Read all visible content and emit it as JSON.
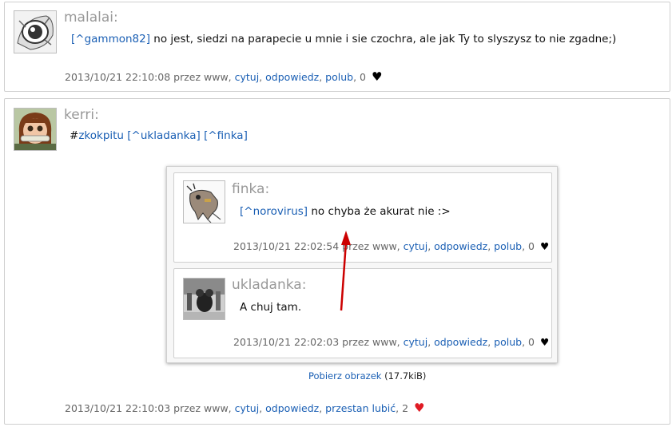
{
  "posts": [
    {
      "author": "malalai:",
      "mention": "[^gammon82]",
      "text": " no jest, siedzi na parapecie u mnie i sie czochra, ale jak Ty to slyszysz to nie zgadne;)",
      "date": "2013/10/21 22:10:08",
      "by": " przez www, ",
      "quote": "cytuj",
      "reply": "odpowiedz",
      "like": "polub",
      "count": ", 0 ",
      "heart": "♥"
    },
    {
      "author": "kerri:",
      "hashtag_prefix": "#",
      "hashtag": "zkokpitu",
      "mention1": "[^ukladanka]",
      "mention2": "[^finka]",
      "date": "2013/10/21 22:10:03",
      "by": " przez www, ",
      "quote": "cytuj",
      "reply": "odpowiedz",
      "like": "przestan lubić",
      "count": ", 2 ",
      "heart": "♥",
      "heart_color": "#e01b24"
    }
  ],
  "embedded": {
    "posts": [
      {
        "author": "finka:",
        "mention": "[^norovirus]",
        "text": " no chyba że akurat nie :>",
        "date": "2013/10/21 22:02:54",
        "by": " przez www, ",
        "quote": "cytuj",
        "reply": "odpowiedz",
        "like": "polub",
        "count": ", 0 ",
        "heart": "♥"
      },
      {
        "author": "ukladanka:",
        "text": "A chuj tam.",
        "date": "2013/10/21 22:02:03",
        "by": " przez www, ",
        "quote": "cytuj",
        "reply": "odpowiedz",
        "like": "polub",
        "count": ", 0 ",
        "heart": "♥"
      }
    ],
    "download_label": "Pobierz obrazek",
    "size": " (17.7kiB)"
  },
  "colors": {
    "link": "#1a5fb4",
    "arrow": "#cc0000"
  }
}
